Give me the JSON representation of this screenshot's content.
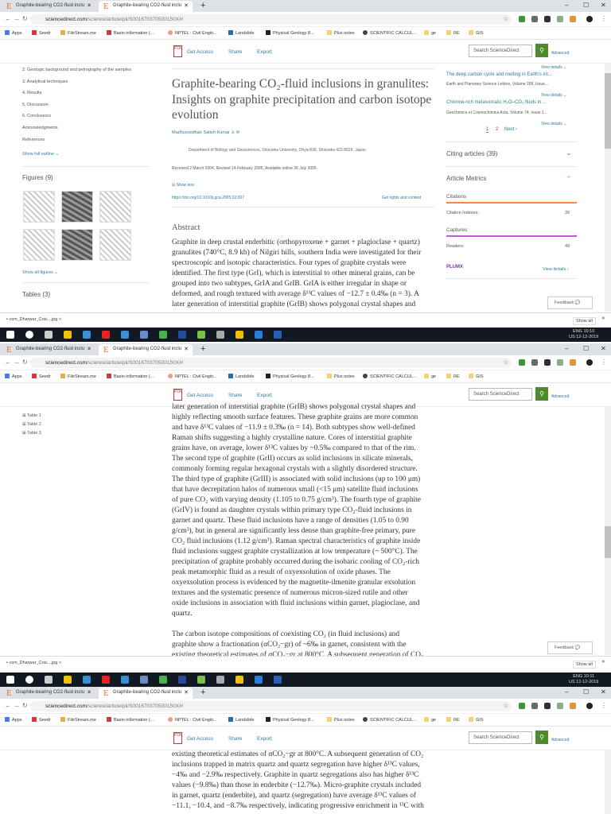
{
  "browser": {
    "tabs": [
      {
        "label": "Graphite-bearing CO2-fluid inclu"
      },
      {
        "label": "Graphite-bearing CO2-fluid inclu"
      }
    ],
    "url_host": "sciencedirect.com",
    "url_path": "/science/article/pii/S001670370500150X#!",
    "bookmarks": [
      "Apps",
      "Seedr",
      "FileStream.me",
      "Basin information |...",
      "NPTEL : Civil Engin...",
      "Landslide",
      "Physical Geology 8...",
      "Plus notes",
      "SCIENTIFIC CALCUL...",
      "ge",
      "RE",
      "GIS"
    ]
  },
  "header": {
    "get_access": "Get Access",
    "share": "Share",
    "export": "Export",
    "search_placeholder": "Search ScienceDirect",
    "advanced": "Advanced",
    "pdf": "PDF"
  },
  "outline": {
    "items": [
      "2. Geologic background and petrography of the samples",
      "3. Analytical techniques",
      "4. Results",
      "5. Discussion",
      "6. Conclusions",
      "Acknowledgments",
      "References"
    ],
    "show_full": "Show full outline",
    "figures": "Figures (9)",
    "show_all_figures": "Show all figures",
    "tables": "Tables (3)",
    "table_items": [
      "Table 1",
      "Table 2",
      "Table 3"
    ]
  },
  "article": {
    "title": "Graphite-bearing CO₂-fluid inclusions in granulites: Insights on graphite precipitation and carbon isotope evolution",
    "author": "Madhusoodhan Satish-Kumar",
    "affiliation": "Department of Biology and Geosciences, Shizuoka University, Ohya-836, Shizuoka 422-8529, Japan",
    "dates": "Received 2 March 2004, Revised 14 February 2005, Available online 26 July 2005.",
    "show_less": "Show less",
    "doi": "https://doi.org/10.1016/j.gca.2005.02.007",
    "rights": "Get rights and content",
    "abstract_heading": "Abstract",
    "lines1": [
      "Graphite in deep crustal enderbitic (orthopyroxene + garnet + plagioclase + quartz)",
      "granulites (740°C, 8.9 kb) of Nilgiri hills, southern India were investigated for their",
      "spectroscopic and isotopic characteristics. Four types of graphite crystals were",
      "identified. The first type (GrI), which is interstitial to other mineral grains, can be",
      "grouped into two subtypes, GrIA and GrIB. GrIA is either irregular in shape or",
      "deformed, and rough textured with average δ¹³C values of −12.7 ± 0.4‰ (n = 3). A",
      "later generation of interstitial graphite (GrIB) shows polygonal crystal shapes and"
    ],
    "lines2": [
      "later generation of interstitial graphite (GrIB) shows polygonal crystal shapes and",
      "highly reflecting smooth surface features. These graphite grains are more common",
      "and have δ¹³C values of −11.9 ± 0.3‰ (n = 14). Both subtypes show well-defined",
      "Raman shifts suggesting a highly crystalline nature. Cores of interstitial graphite",
      "grains have, on average, lower δ¹³C values by ~0.5‰ compared to that of the rim.",
      "The second type of graphite (GrII) occurs as solid inclusions in silicate minerals,",
      "commonly forming regular hexagonal crystals with a slightly disordered structure.",
      "The third type of graphite (GrIII) is associated with solid inclusions (up to 100 μm)",
      "that have decrepitation halos of numerous small (<15 μm) satellite fluid inclusions",
      "of pure CO₂ with varying density (1.105 to 0.75 g/cm³). The fourth type of graphite",
      "(GrIV) is found as daughter crystals within primary type CO₂-fluid inclusions in",
      "garnet and quartz. These fluid inclusions have a range of densities (1.05 to 0.90",
      "g/cm³), but in general are significantly less dense than graphite-free primary, pure",
      "CO₂ fluid inclusions (1.12 g/cm³). Raman spectral characteristics of graphite inside",
      "fluid inclusions suggest graphite crystallization at low temperature (~ 500°C). The",
      "precipitation of graphite probably occurred during the isobaric cooling of CO₂-rich",
      "peak metamorphic fluid as a result of oxyexsolution of oxide phases. The",
      "oxyexsolution process is evidenced by the magnetite-ilmenite granular exsolution",
      "textures and the systematic presence of numerous micron-sized rutile and other",
      "oxide inclusions in association with fluid inclusions within garnet, plagioclase, and",
      "quartz.",
      "",
      "The carbon isotope compositions of coexisting CO₂ (in fluid inclusions) and",
      "graphite show a fractionation (αCO₂−gr) of ~6‰ in garnet, consistent with the",
      "existing theoretical estimates of αCO₂−gr at 800°C. A subsequent generation of CO₂"
    ],
    "lines3": [
      "existing theoretical estimates of αCO₂−gr at 800°C. A subsequent generation of CO₂",
      "inclusions trapped in matrix quartz and quartz segregation have higher δ¹³C values,",
      "−4‰ and −2.9‰ respectively. Graphite in quartz segregations also has higher δ¹³C",
      "values (−9.8‰) than those in enderbite (−12.7‰). Micro-graphite crystals included",
      "in garnet, quartz (enderbite), and quartz (segregation) have average δ¹³C values of",
      "−11.1, −10.4, and −8.7‰ respectively, indicating progressive enrichment in ¹³C with"
    ]
  },
  "sidebar": {
    "view_details": "View details",
    "rec1_title": "The deep carbon cycle and melting in Earth's int...",
    "rec1_source": "Earth and Planetary Science Letters, Volume 298, Issue...",
    "rec2_title": "Chlorine-rich metasomatic H₂O–CO₂ fluids in ...",
    "rec2_source": "Geochimica et Cosmochimica Acta, Volume 74, Issue 1...",
    "page1": "1",
    "page2": "2",
    "next": "Next",
    "citing": "Citing articles (39)",
    "metrics": "Article Metrics",
    "citations": "Citations",
    "citation_indexes": "Citation Indexes:",
    "citation_count": "39",
    "captures": "Captures",
    "readers": "Readers:",
    "readers_count": "49",
    "plumx": "PLUMX",
    "view_details2": "View details"
  },
  "feedback": "Feedback",
  "download": {
    "file": "csm_Dharwar_Crat....jpg",
    "show_all": "Show all"
  },
  "taskbar": [
    {
      "lang": "ENG",
      "region": "US",
      "time": "10:10",
      "date": "12-12-2019"
    },
    {
      "lang": "ENG",
      "region": "US",
      "time": "10:11",
      "date": "12-12-2019"
    }
  ],
  "colors": {
    "accent": "#2e7c9a",
    "search_green": "#4f8a2e",
    "citations": "#f08a4b",
    "captures": "#c45ad6"
  }
}
